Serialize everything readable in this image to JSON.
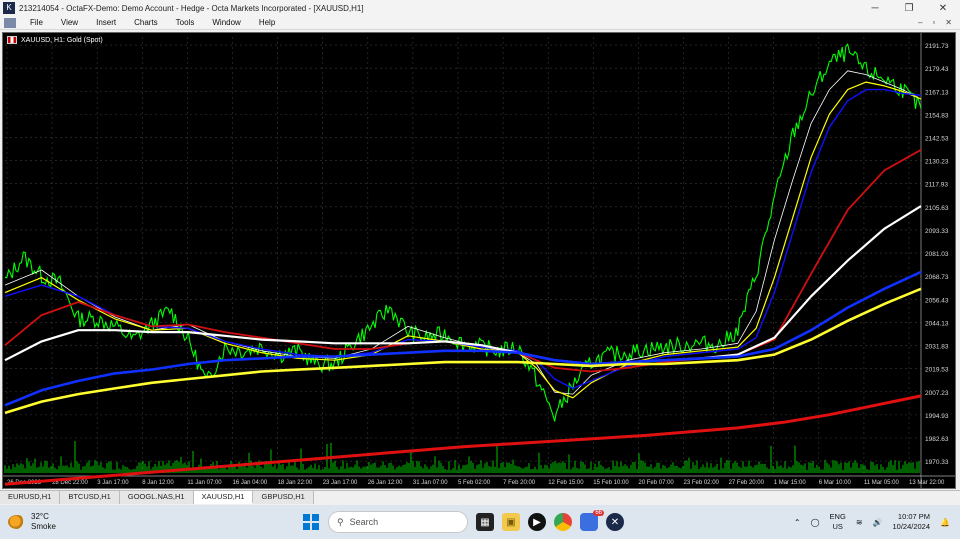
{
  "window": {
    "title": "213214054 - OctaFX-Demo: Demo Account - Hedge - Octa Markets Incorporated - [XAUUSD,H1]",
    "controls": [
      "─",
      "❐",
      "✕"
    ],
    "mdi_controls": [
      "–",
      "▫",
      "✕"
    ]
  },
  "menu": [
    "File",
    "View",
    "Insert",
    "Charts",
    "Tools",
    "Window",
    "Help"
  ],
  "chart_label": "XAUUSD, H1:  Gold (Spot)",
  "tabs": [
    "EURUSD,H1",
    "BTCUSD,H1",
    "GOOGL.NAS,H1",
    "XAUUSD,H1",
    "GBPUSD,H1"
  ],
  "active_tab": 3,
  "taskbar": {
    "weather_temp": "32°C",
    "weather_desc": "Smoke",
    "search_placeholder": "Search",
    "lang_line1": "ENG",
    "lang_line2": "US",
    "time": "10:07 PM",
    "date": "10/24/2024",
    "browser_badge": "66"
  },
  "chart_data": {
    "type": "line",
    "symbol": "XAUUSD",
    "timeframe": "H1",
    "x_tick_labels": [
      "26 Dec 2023",
      "28 Dec 22:00",
      "3 Jan 17:00",
      "8 Jan 12:00",
      "11 Jan 07:00",
      "16 Jan 04:00",
      "18 Jan 22:00",
      "23 Jan 17:00",
      "26 Jan 12:00",
      "31 Jan 07:00",
      "5 Feb 02:00",
      "7 Feb 20:00",
      "12 Feb 15:00",
      "15 Feb 10:00",
      "20 Feb 07:00",
      "23 Feb 02:00",
      "27 Feb 20:00",
      "1 Mar 15:00",
      "6 Mar 10:00",
      "11 Mar 05:00",
      "13 Mar 22:00"
    ],
    "y_tick_labels": [
      "2191.73",
      "2179.43",
      "2167.13",
      "2154.83",
      "2142.53",
      "2130.23",
      "2117.93",
      "2105.63",
      "2093.33",
      "2081.03",
      "2068.73",
      "2056.43",
      "2044.13",
      "2031.83",
      "2019.53",
      "2007.23",
      "1994.93",
      "1982.63",
      "1970.33"
    ],
    "ylim": [
      1964,
      2196
    ],
    "grid": true,
    "colors": {
      "background": "#000000",
      "price": "#00ff00",
      "ma_fast_white": "#ffffff",
      "ma_fast_yellow": "#ffff00",
      "ma_fast_blue": "#0000ff",
      "ma_mid_red": "#d01010",
      "ma_slow_white": "#ffffff",
      "ma_slow_blue": "#1030ff",
      "ma_slow_yellow": "#ffff30",
      "ma_long_red": "#e01010",
      "volume": "#00c000"
    },
    "series": [
      {
        "color": "#00ff00",
        "x": [
          0,
          2,
          4,
          6,
          8,
          10,
          12,
          14,
          16,
          18,
          20,
          22,
          24,
          26,
          28,
          30,
          32,
          34,
          36,
          38,
          40,
          42,
          44,
          46,
          48,
          50,
          52,
          54,
          56,
          58,
          60,
          62,
          64,
          66,
          68,
          70,
          72,
          74,
          76,
          78,
          80,
          82,
          84,
          86,
          88,
          90,
          92,
          94,
          96,
          98,
          100
        ],
        "values": [
          2066,
          2079,
          2069,
          2065,
          2046,
          2046,
          2042,
          2035,
          2043,
          2051,
          2035,
          2012,
          2031,
          2029,
          2031,
          2027,
          2029,
          2022,
          2022,
          2033,
          2042,
          2052,
          2039,
          2036,
          2038,
          2033,
          2031,
          2029,
          2031,
          2014,
          1994,
          2011,
          2023,
          2027,
          2028,
          2030,
          2031,
          2032,
          2033,
          2032,
          2040,
          2070,
          2110,
          2144,
          2165,
          2182,
          2188,
          2178,
          2174,
          2168,
          2158
        ]
      },
      {
        "color": "#ffffff",
        "width": 0.8,
        "x": [
          0,
          4,
          8,
          12,
          16,
          20,
          24,
          28,
          32,
          36,
          40,
          44,
          48,
          52,
          56,
          58,
          60,
          62,
          64,
          68,
          72,
          76,
          80,
          82,
          84,
          86,
          88,
          90,
          92,
          94,
          96,
          98,
          100
        ],
        "values": [
          2064,
          2072,
          2058,
          2047,
          2040,
          2043,
          2034,
          2029,
          2026,
          2025,
          2030,
          2042,
          2036,
          2031,
          2028,
          2022,
          2007,
          2006,
          2016,
          2024,
          2028,
          2030,
          2033,
          2050,
          2088,
          2120,
          2150,
          2168,
          2178,
          2176,
          2172,
          2168,
          2163
        ]
      },
      {
        "color": "#ffff00",
        "width": 1.2,
        "x": [
          0,
          4,
          8,
          12,
          16,
          20,
          24,
          28,
          32,
          36,
          40,
          44,
          48,
          52,
          56,
          58,
          60,
          62,
          64,
          68,
          72,
          76,
          80,
          82,
          84,
          86,
          88,
          90,
          92,
          94,
          96,
          98,
          100
        ],
        "values": [
          2060,
          2068,
          2056,
          2046,
          2040,
          2041,
          2033,
          2028,
          2025,
          2024,
          2027,
          2037,
          2034,
          2030,
          2028,
          2020,
          2008,
          2004,
          2012,
          2022,
          2027,
          2029,
          2031,
          2041,
          2068,
          2100,
          2132,
          2155,
          2168,
          2172,
          2170,
          2167,
          2163
        ]
      },
      {
        "color": "#1010ff",
        "width": 1.4,
        "x": [
          0,
          4,
          8,
          12,
          16,
          20,
          24,
          28,
          32,
          36,
          40,
          44,
          48,
          52,
          56,
          58,
          60,
          62,
          64,
          68,
          72,
          76,
          80,
          82,
          84,
          86,
          88,
          90,
          92,
          94,
          96,
          98,
          100
        ],
        "values": [
          2058,
          2064,
          2058,
          2048,
          2042,
          2041,
          2034,
          2030,
          2027,
          2026,
          2028,
          2035,
          2034,
          2031,
          2029,
          2024,
          2014,
          2009,
          2013,
          2021,
          2026,
          2028,
          2030,
          2036,
          2060,
          2092,
          2124,
          2148,
          2162,
          2168,
          2168,
          2166,
          2165
        ]
      },
      {
        "color": "#d01010",
        "width": 1.8,
        "x": [
          0,
          4,
          8,
          12,
          16,
          20,
          24,
          28,
          32,
          36,
          40,
          44,
          48,
          52,
          56,
          60,
          64,
          68,
          72,
          76,
          80,
          84,
          88,
          92,
          96,
          100
        ],
        "values": [
          2032,
          2048,
          2055,
          2048,
          2042,
          2043,
          2039,
          2036,
          2033,
          2030,
          2030,
          2033,
          2034,
          2032,
          2028,
          2020,
          2018,
          2020,
          2023,
          2025,
          2027,
          2035,
          2070,
          2104,
          2125,
          2136
        ]
      },
      {
        "color": "#ffffff",
        "width": 2.2,
        "x": [
          0,
          4,
          8,
          12,
          16,
          20,
          24,
          28,
          32,
          36,
          40,
          44,
          48,
          52,
          56,
          60,
          64,
          68,
          72,
          76,
          80,
          84,
          88,
          92,
          96,
          100
        ],
        "values": [
          2024,
          2034,
          2040,
          2040,
          2039,
          2039,
          2037,
          2035,
          2034,
          2033,
          2033,
          2033,
          2034,
          2032,
          2028,
          2024,
          2022,
          2023,
          2024,
          2025,
          2027,
          2036,
          2058,
          2077,
          2094,
          2106
        ]
      },
      {
        "color": "#1030ff",
        "width": 2.6,
        "x": [
          0,
          4,
          8,
          12,
          16,
          20,
          24,
          28,
          32,
          36,
          40,
          44,
          48,
          52,
          56,
          60,
          64,
          68,
          72,
          76,
          80,
          84,
          88,
          92,
          96,
          100
        ],
        "values": [
          2000,
          2008,
          2013,
          2017,
          2019,
          2022,
          2024,
          2025,
          2026,
          2026,
          2027,
          2028,
          2029,
          2029,
          2028,
          2024,
          2022,
          2023,
          2024,
          2025,
          2026,
          2030,
          2040,
          2052,
          2062,
          2071
        ]
      },
      {
        "color": "#ffff30",
        "width": 2.6,
        "x": [
          0,
          4,
          8,
          12,
          16,
          20,
          24,
          28,
          32,
          36,
          40,
          44,
          48,
          52,
          56,
          60,
          64,
          68,
          72,
          76,
          80,
          84,
          88,
          92,
          96,
          100
        ],
        "values": [
          1996,
          2002,
          2006,
          2009,
          2012,
          2014,
          2016,
          2018,
          2019,
          2020,
          2021,
          2022,
          2023,
          2023,
          2023,
          2022,
          2021,
          2022,
          2022,
          2023,
          2024,
          2027,
          2035,
          2045,
          2054,
          2062
        ]
      },
      {
        "color": "#e01010",
        "width": 3,
        "x": [
          0,
          10,
          20,
          30,
          40,
          50,
          60,
          70,
          80,
          85,
          90,
          95,
          100
        ],
        "values": [
          1958,
          1962,
          1966,
          1970,
          1974,
          1978,
          1981,
          1984,
          1988,
          1991,
          1995,
          2000,
          2005
        ]
      }
    ]
  }
}
